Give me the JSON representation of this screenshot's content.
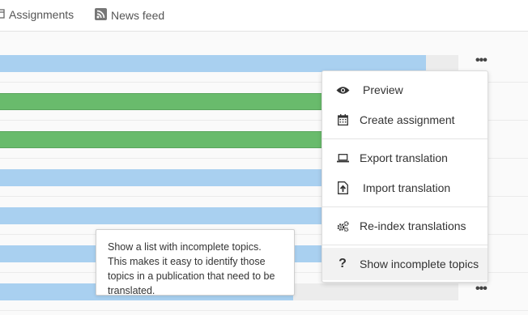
{
  "nav": {
    "assignments_label": "Assignments",
    "newsfeed_label": "News feed"
  },
  "rows": [
    {
      "color": "blue",
      "progress": 0.93
    },
    {
      "color": "green",
      "progress": 1.0
    },
    {
      "color": "green",
      "progress": 1.0
    },
    {
      "color": "blue",
      "progress": 1.0
    },
    {
      "color": "blue",
      "progress": 1.0
    },
    {
      "color": "blue",
      "progress": 1.0
    },
    {
      "color": "blue",
      "progress": 0.64
    }
  ],
  "colors": {
    "blue": "#a9d0f0",
    "green": "#69bb6c"
  },
  "more_menu": {
    "items": [
      {
        "label": "Preview",
        "icon": "eye-icon"
      },
      {
        "label": "Create assignment",
        "icon": "calendar-icon"
      },
      {
        "label": "Export translation",
        "icon": "laptop-icon"
      },
      {
        "label": "Import translation",
        "icon": "file-import-icon"
      },
      {
        "label": "Re-index translations",
        "icon": "cogs-icon"
      },
      {
        "label": "Show incomplete topics",
        "icon": "question-icon"
      }
    ]
  },
  "tooltip": {
    "text": "Show a list with incomplete topics. This makes it easy to identify those topics in a publication that need to be translated."
  }
}
